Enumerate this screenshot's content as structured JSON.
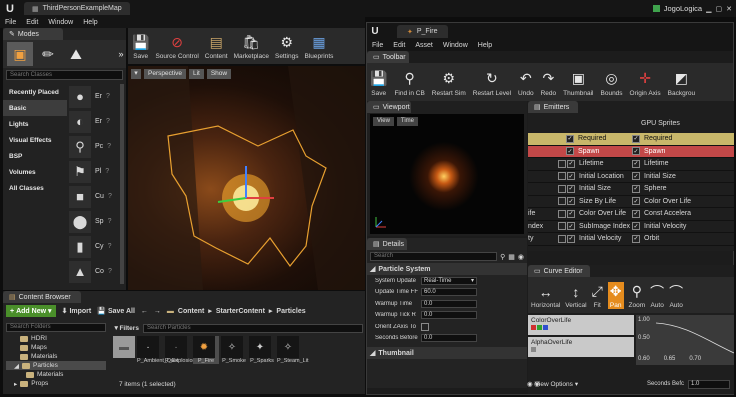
{
  "main": {
    "title": "ThirdPersonExampleMap",
    "menu": [
      "File",
      "Edit",
      "Window",
      "Help"
    ],
    "user": "JogoLogica"
  },
  "modes": {
    "tab": "Modes",
    "search_placeholder": "Search Classes",
    "categories": [
      "Recently Placed",
      "Basic",
      "Lights",
      "Visual Effects",
      "BSP",
      "Volumes",
      "All Classes"
    ],
    "selected_category": "Basic",
    "classes": [
      {
        "label": "Er",
        "icon": "●"
      },
      {
        "label": "Er",
        "icon": "◐"
      },
      {
        "label": "Pc",
        "icon": "⚲"
      },
      {
        "label": "Pl",
        "icon": "⚑"
      },
      {
        "label": "Cu",
        "icon": "■"
      },
      {
        "label": "Sp",
        "icon": "⬤"
      },
      {
        "label": "Cy",
        "icon": "▮"
      },
      {
        "label": "Co",
        "icon": "▲"
      }
    ]
  },
  "level_toolbar": {
    "buttons": [
      "Save",
      "Source Control",
      "Content",
      "Marketplace",
      "Settings",
      "Blueprints"
    ]
  },
  "level_viewport": {
    "perspective": "Perspective",
    "lit": "Lit",
    "show": "Show"
  },
  "content_browser": {
    "tab": "Content Browser",
    "add_new": "Add New",
    "import": "Import",
    "save_all": "Save All",
    "path": [
      "Content",
      "StarterContent",
      "Particles"
    ],
    "folder_search": "Search Folders",
    "filters": "Filters",
    "asset_search": "Search Particles",
    "folders": [
      "HDRI",
      "Maps",
      "Materials",
      "Particles",
      "Materials",
      "Props"
    ],
    "selected_folder": "Particles",
    "assets": [
      "P_Ambient_Dust",
      "P_Explosion",
      "P_Fire",
      "P_Smoke",
      "P_Sparks",
      "P_Steam_Lit"
    ],
    "selected_asset": "P_Fire",
    "status": "7 items (1 selected)",
    "view_options": "View Options"
  },
  "cascade": {
    "title": "P_Fire",
    "menu": [
      "File",
      "Edit",
      "Asset",
      "Window",
      "Help"
    ],
    "toolbar_tab": "Toolbar",
    "toolbar": [
      "Save",
      "Find in CB",
      "Restart Sim",
      "Restart Level",
      "Undo",
      "Redo",
      "Thumbnail",
      "Bounds",
      "Origin Axis",
      "Backgrou"
    ],
    "viewport_tab": "Viewport",
    "viewport_buttons": [
      "View",
      "Time"
    ],
    "emitters_tab": "Emitters",
    "emitters": {
      "col1": [
        "Required",
        "Spawn",
        "Lifetime",
        "Initial Location",
        "Initial Size",
        "Size By Life",
        "Color Over Life",
        "SubImage Index",
        "Initial Velocity"
      ],
      "col2_header": "GPU Sprites",
      "col2": [
        "Required",
        "Spawn",
        "Lifetime",
        "Initial Size",
        "Sphere",
        "Color Over Life",
        "Const Accelera",
        "Initial Velocity",
        "Orbit"
      ],
      "left_cut": [
        "",
        "",
        "",
        "",
        "",
        "ife",
        "ndex",
        "ty",
        ""
      ]
    },
    "details": {
      "tab": "Details",
      "search_placeholder": "Search",
      "section": "Particle System",
      "rows": [
        {
          "label": "System Update",
          "value": "Real-Time",
          "type": "select"
        },
        {
          "label": "Update Time FF",
          "value": "60.0",
          "type": "number"
        },
        {
          "label": "Warmup Time",
          "value": "0.0",
          "type": "number"
        },
        {
          "label": "Warmup Tick R",
          "value": "0.0",
          "type": "number"
        },
        {
          "label": "Orient ZAxis To",
          "value": "",
          "type": "check"
        },
        {
          "label": "Seconds Before",
          "value": "0.0",
          "type": "number"
        }
      ],
      "thumbnail_section": "Thumbnail"
    },
    "curve_editor": {
      "tab": "Curve Editor",
      "buttons": [
        "Horizontal",
        "Vertical",
        "Fit",
        "Pan",
        "Zoom",
        "Auto",
        "Auto"
      ],
      "active_button": "Pan",
      "tracks": [
        "ColorOverLife",
        "AlphaOverLife"
      ],
      "y_labels": [
        "1.00",
        "0.50"
      ],
      "x_labels": [
        "0.60",
        "0.65",
        "0.70"
      ],
      "seconds_label": "Seconds Befc",
      "seconds_value": "1.0"
    }
  },
  "colors": {
    "accent_orange": "#e58c1e",
    "add_green": "#4a8f2a",
    "required_yellow": "#c8b76a",
    "spawn_red": "#c24848"
  }
}
